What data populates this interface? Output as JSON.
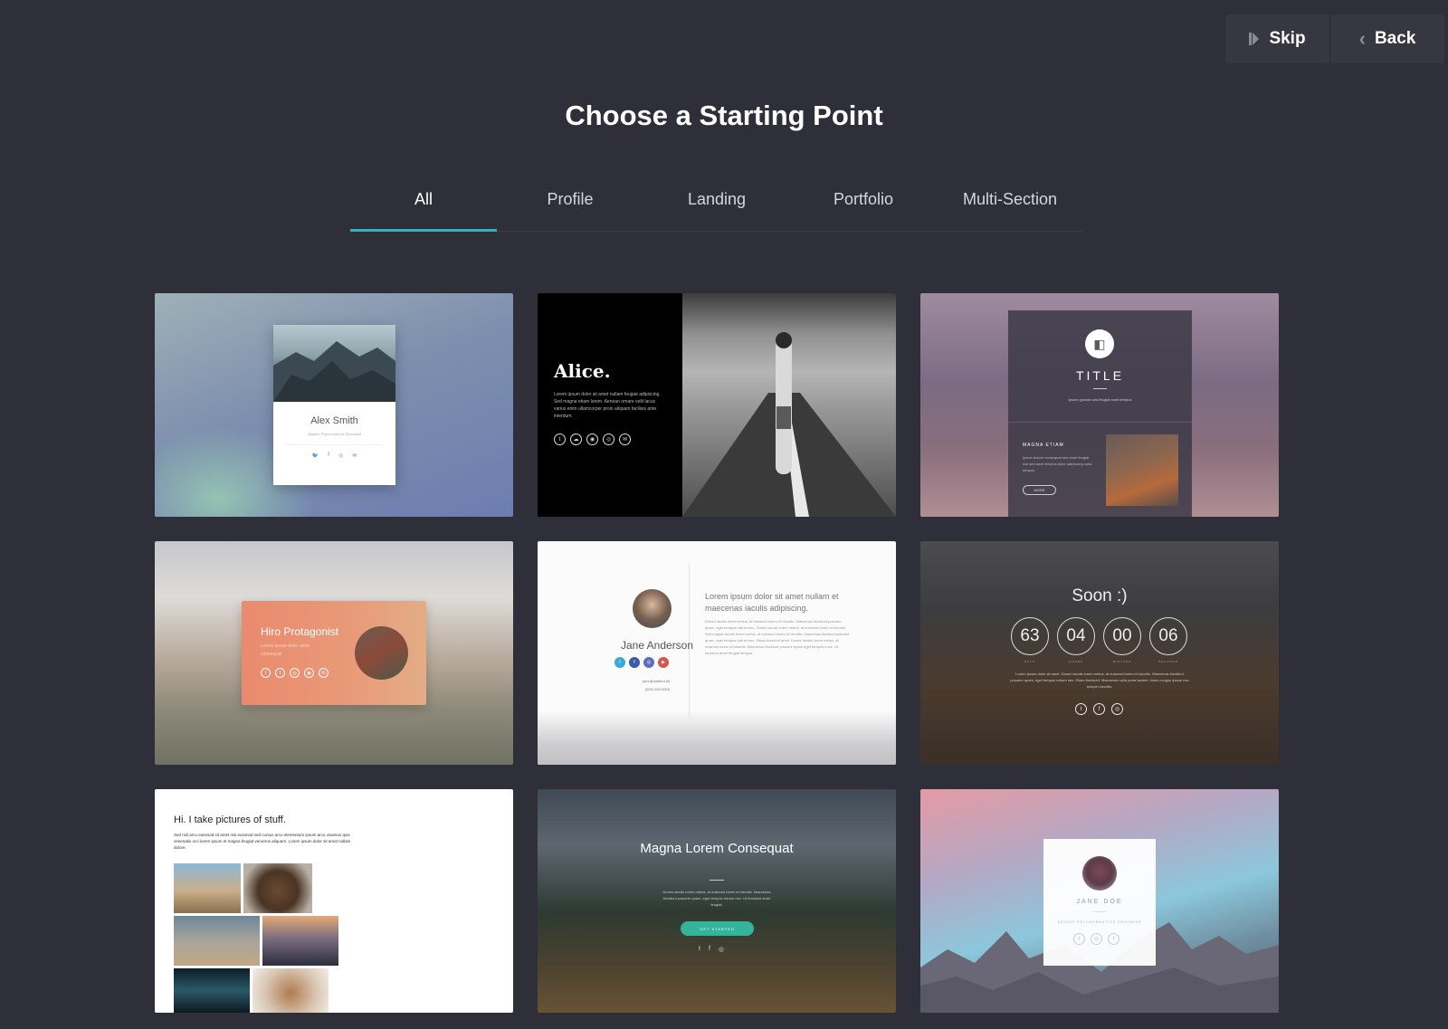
{
  "topbar": {
    "skip_label": "Skip",
    "back_label": "Back"
  },
  "page_title": "Choose a Starting Point",
  "tabs": [
    {
      "label": "All",
      "active": true
    },
    {
      "label": "Profile",
      "active": false
    },
    {
      "label": "Landing",
      "active": false
    },
    {
      "label": "Portfolio",
      "active": false
    },
    {
      "label": "Multi-Section",
      "active": false
    }
  ],
  "colors": {
    "background": "#2e2f38",
    "tab_underline": "#2fb1b9",
    "cta_green": "#35b49c"
  },
  "templates": {
    "alex": {
      "name": "Alex Smith",
      "subtitle": "Applied Psychometrics Specialist"
    },
    "alice": {
      "name": "Alice.",
      "text": "Lorem ipsum dolor sit amet nullam feugiat adipiscing. Sed magna etiam lorem. Aenean ornare velit lacus varius enim ullamcorper proin aliquam facilisis ante interdum."
    },
    "title_card": {
      "title": "TITLE",
      "subtitle": "Ipsum gravida sed feugiat amet tempus",
      "section": "MAGNA ETIAM",
      "text": "Ipsum dolore consequat sed amet feugiat nisi sed amet tempus dolor adipiscing nulla tempus.",
      "more": "MORE"
    },
    "hiro": {
      "name": "Hiro Protagonist",
      "subtitle": "Lorem ipsum dolor amet consequat"
    },
    "jane_anderson": {
      "name": "Jane Anderson",
      "email": "jane@untitled.tld",
      "phone": "(000) 000-0000",
      "heading": "Lorem ipsum dolor sit amet nullam et maecenas iaculis adipiscing.",
      "body": "Donec iaculis lorem metus, at euismod lorem et lobortis. Maecenas tincidunt posuere quam, eget tempus rutrum nec. Donec iaculis lorem metus, at euismod lorem et lobortis. Sed magna iaculis lorem metus, at euismod lorem et lobortis. Maecenas tincidunt posuere quam, eget tempus rutrum nec. Etiam tincidunt amet. Donec iaculis lorem metus, at euismod lorem et lobortis. Maecenas tincidunt posuere quam eget tempus nunc. Ut tincidunt amet feugiat tempus."
    },
    "soon": {
      "title": "Soon :)",
      "countdown": [
        {
          "value": "63",
          "label": "DAYS"
        },
        {
          "value": "04",
          "label": "HOURS"
        },
        {
          "value": "00",
          "label": "MINUTES"
        },
        {
          "value": "06",
          "label": "SECONDS"
        }
      ],
      "text": "Lorem ipsum dolor sit amet. Donec iaculis lorem metus, at euismod lorem et lobortis. Maecenas tincidunt posuere quam, eget tempus rutrum nec. Etiam tincidunt. Maecenas nulla porta laoreet. Nunc congue ipsum nec semper lobortis."
    },
    "portfolio": {
      "heading": "Hi. I take pictures of stuff.",
      "text": "Sed nisl arcu euismod sit amet nisi euismod sed cursus arcu elementum ipsum arcu vivamus quis venenatis orci lorem ipsum et magna feugiat veroeros aliquam. Lorem ipsum dolor sit amet nullam dolore."
    },
    "magna": {
      "heading": "Magna Lorem Consequat",
      "text": "Donec iaculis lorem metus, at euismod lorem et lobortis. Maecenas tincidunt posuere quam, eget tempus rutrum nec. Ut tincidunt amet feugiat.",
      "button": "GET STARTED"
    },
    "jane_doe": {
      "name": "JANE DOE",
      "subtitle": "SENIOR PSYCHONAUTICS ENGINEER"
    }
  }
}
